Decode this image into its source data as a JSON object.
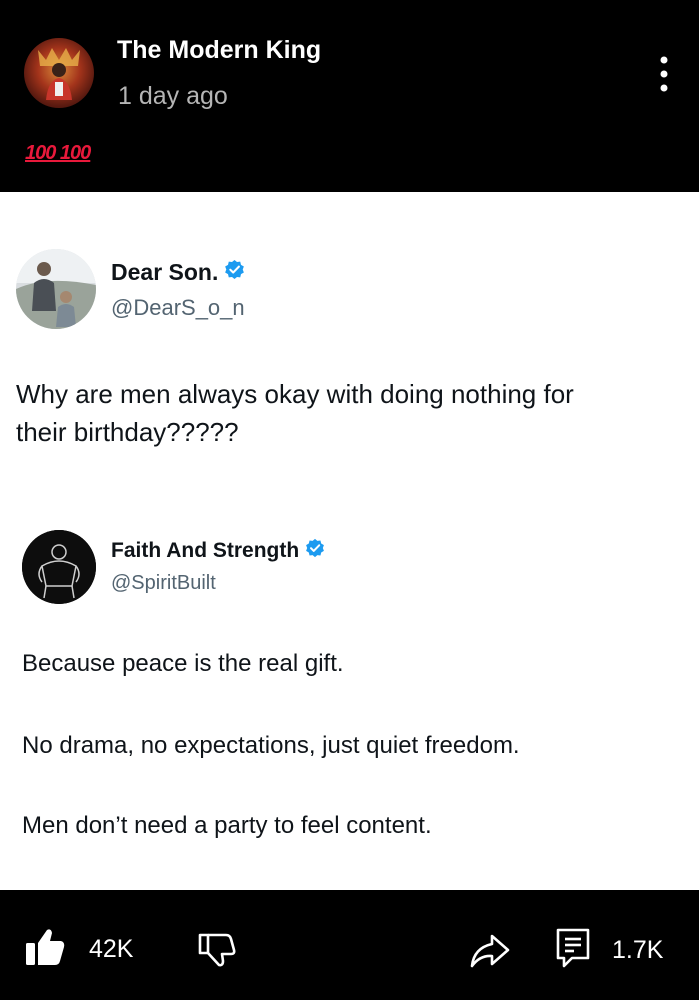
{
  "header": {
    "channel_name": "The Modern King",
    "post_time": "1 day ago",
    "caption": "💯💯",
    "caption_text": "100 100"
  },
  "tweet_1": {
    "name": "Dear Son.",
    "handle": "@DearS_o_n",
    "text_line1": "Why are men always okay with doing nothing for",
    "text_line2": "their birthday?????"
  },
  "tweet_2": {
    "name": "Faith And Strength",
    "handle": "@SpiritBuilt",
    "para1": "Because peace is the real gift.",
    "para2": "No drama, no expectations, just quiet freedom.",
    "para3": "Men don’t need a party to feel content."
  },
  "actions": {
    "likes": "42K",
    "comments": "1.7K"
  },
  "colors": {
    "verified": "#1d9bf0",
    "caption_red": "#e8193b"
  },
  "icons": [
    "more-vertical-icon",
    "verified-badge-icon",
    "thumbs-up-icon",
    "thumbs-down-icon",
    "share-icon",
    "comment-icon"
  ]
}
